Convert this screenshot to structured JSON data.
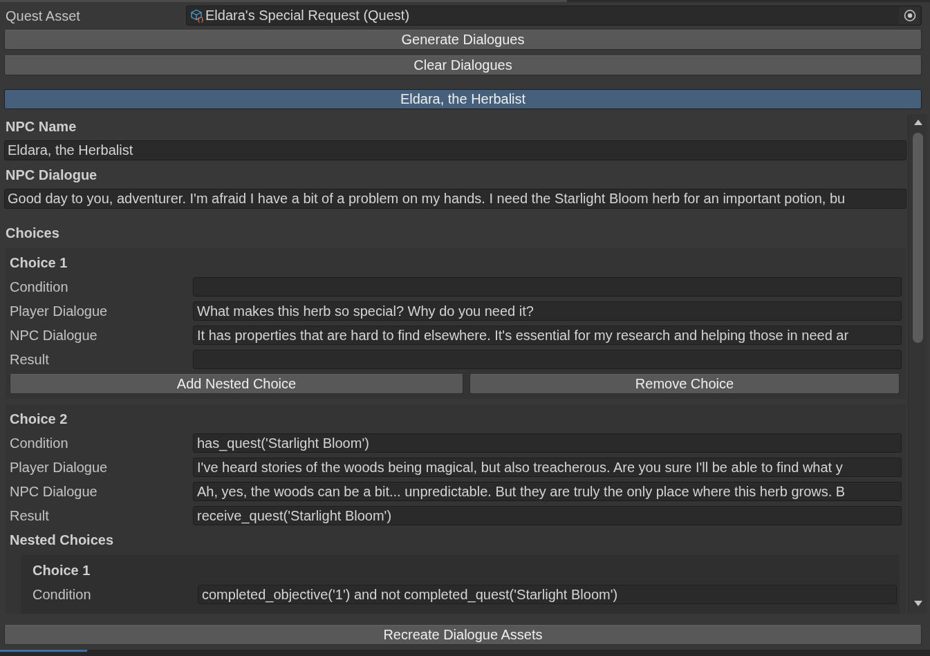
{
  "quest_asset": {
    "label": "Quest Asset",
    "value": "Eldara's Special Request (Quest)"
  },
  "actions": [
    {
      "label": "Generate Dialogues"
    },
    {
      "label": "Clear Dialogues"
    }
  ],
  "npc_tab": {
    "label": "Eldara, the Herbalist",
    "selected": true
  },
  "npc_name": {
    "label": "NPC Name",
    "value": "Eldara, the Herbalist"
  },
  "npc_dialogue": {
    "label": "NPC Dialogue",
    "value": "Good day to you, adventurer. I'm afraid I have a bit of a problem on my hands. I need the Starlight Bloom herb for an important potion, bu"
  },
  "choices": {
    "label": "Choices",
    "items": [
      {
        "title": "Choice 1",
        "fields": [
          {
            "label": "Condition"
          },
          {
            "label": "Player Dialogue",
            "value": "What makes this herb so special? Why do you need it?"
          },
          {
            "label": "NPC Dialogue",
            "value": "It has properties that are hard to find elsewhere. It's essential for my research and helping those in need ar"
          },
          {
            "label": "Result"
          }
        ],
        "buttons": [
          {
            "label": "Add Nested Choice"
          },
          {
            "label": "Remove Choice"
          }
        ]
      },
      {
        "title": "Choice 2",
        "fields": [
          {
            "label": "Condition",
            "value": "has_quest('Starlight Bloom')"
          },
          {
            "label": "Player Dialogue",
            "value": "I've heard stories of the woods being magical, but also treacherous. Are you sure I'll be able to find what y"
          },
          {
            "label": "NPC Dialogue",
            "value": "Ah, yes, the woods can be a bit... unpredictable. But they are truly the only place where this herb grows. B"
          },
          {
            "label": "Result",
            "value": "receive_quest('Starlight Bloom')"
          }
        ],
        "nested": {
          "label": "Nested Choices",
          "items": [
            {
              "title": "Choice 1",
              "fields": [
                {
                  "label": "Condition",
                  "value": "completed_objective('1') and not completed_quest('Starlight Bloom')"
                }
              ]
            }
          ]
        }
      }
    ]
  },
  "footer_button": {
    "label": "Recreate Dialogue Assets"
  },
  "progress_bar": {
    "level": 0.094
  }
}
